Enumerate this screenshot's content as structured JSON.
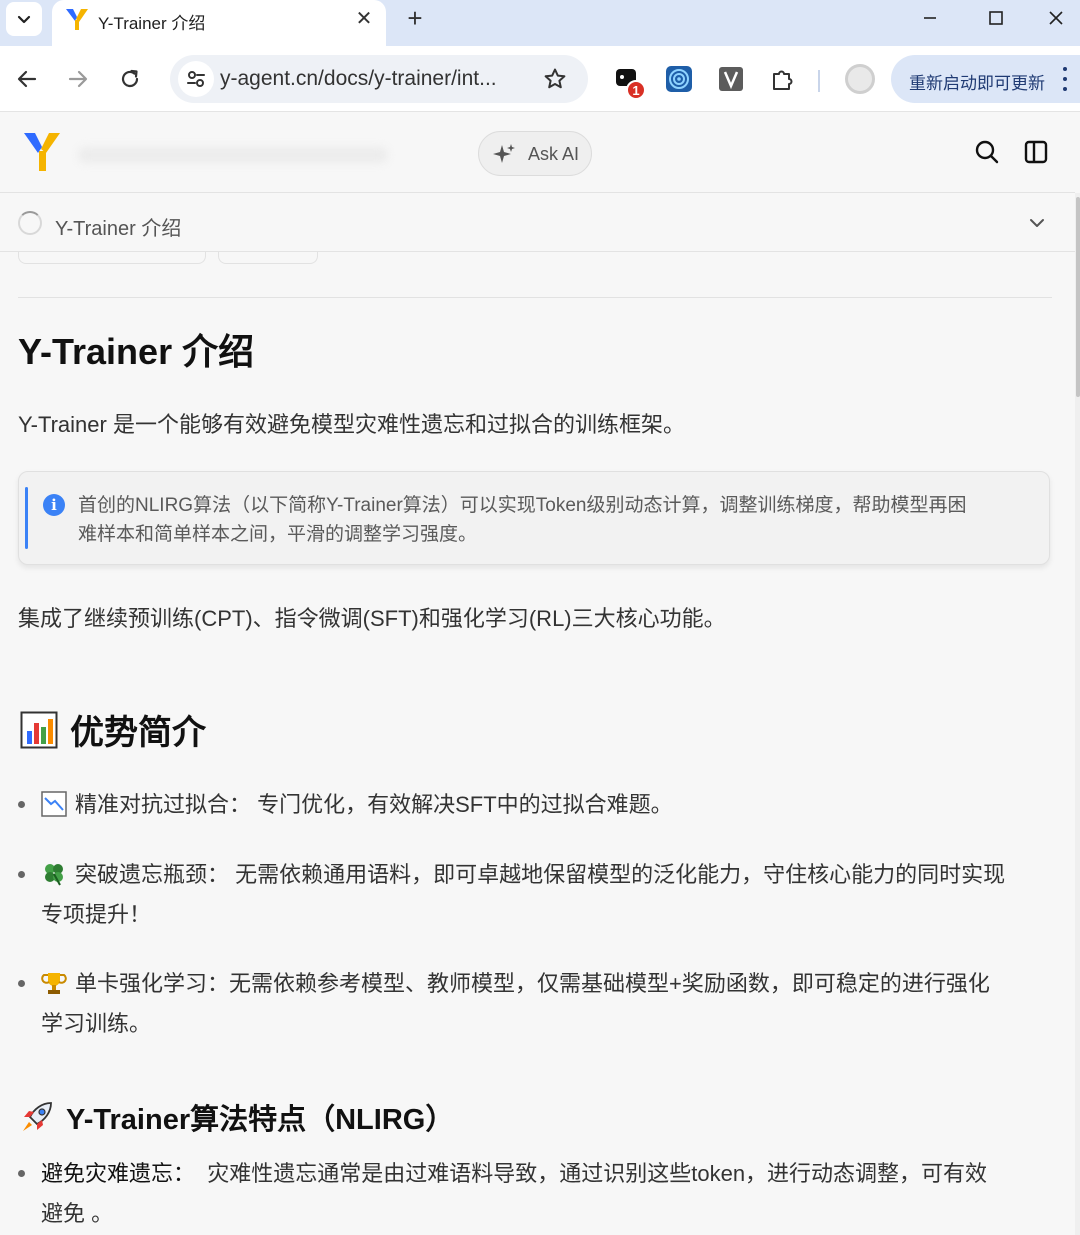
{
  "browser": {
    "tab_title": "Y-Trainer 介绍",
    "url": "y-agent.cn/docs/y-trainer/int...",
    "extension_badge": "1",
    "update_label": "重新启动即可更新"
  },
  "page": {
    "ask_ai_label": "Ask AI",
    "breadcrumb": "Y-Trainer 介绍",
    "title": "Y-Trainer 介绍",
    "intro": "Y-Trainer 是一个能够有效避免模型灾难性遗忘和过拟合的训练框架。",
    "callout_line1": "首创的NLIRG算法（以下简称Y-Trainer算法）可以实现Token级别动态计算，调整训练梯度，帮助模型再困",
    "callout_line2": "难样本和简单样本之间，平滑的调整学习强度。",
    "integration": "集成了继续预训练(CPT)、指令微调(SFT)和强化学习(RL)三大核心功能。",
    "advantages_heading": "优势简介",
    "advantages": [
      {
        "icon": "chart-down-icon",
        "line1": "精准对抗过拟合：  专门优化，有效解决SFT中的过拟合难题。",
        "line2": ""
      },
      {
        "icon": "clover-icon",
        "line1": "突破遗忘瓶颈：  无需依赖通用语料，即可卓越地保留模型的泛化能力，守住核心能力的同时实现",
        "line2": "专项提升！"
      },
      {
        "icon": "trophy-icon",
        "line1": "单卡强化学习：无需依赖参考模型、教师模型，仅需基础模型+奖励函数，即可稳定的进行强化",
        "line2": "学习训练。"
      }
    ],
    "algo_heading": "Y-Trainer算法特点（NLIRG）",
    "algo_item_term": "避免灾难遗忘：",
    "algo_item_line1": "  灾难性遗忘通常是由过难语料导致，通过识别这些token，进行动态调整，可有效",
    "algo_item_line2": "避免 。"
  },
  "colors": {
    "accent": "#3b82f6",
    "tabbar": "#dce6f7",
    "page_bg": "#f7f7f7"
  }
}
